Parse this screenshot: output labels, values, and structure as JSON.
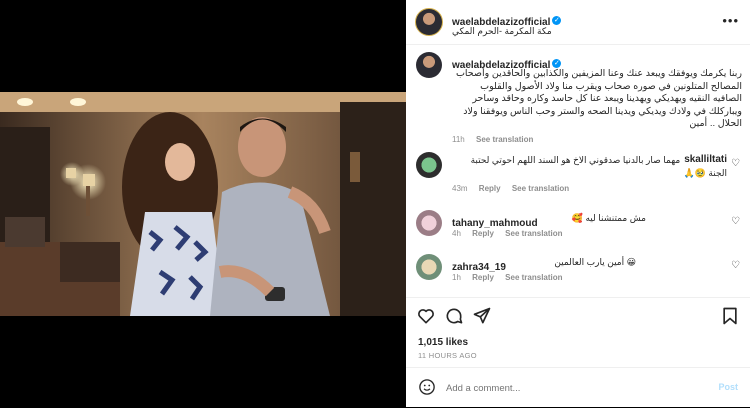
{
  "post": {
    "username": "waelabdelazizofficial",
    "location": "مكة المكرمة -الحرم المكي",
    "caption": "ربنا يكرمك ويوفقك ويبعد عنك وعنا المزيفين والكذابين والحاقدين وأصحاب المصالح المتلونين في صوره صحاب ويقرب منا ولاد الأصول والقلوب الصافيه النقيه ويهديكي ويهدينا ويبعد عنا كل حاسد وكاره وحاقد وساحر ويباركلك في ولادك ويديكي ويدينا الصحه والستر وحب الناس ويوفقنا ولاد الحلال .. أمين",
    "caption_time": "11h",
    "see_translation": "See translation",
    "likes": "1,015 likes",
    "time_ago": "11 HOURS AGO",
    "add_comment_placeholder": "Add a comment...",
    "post_button": "Post"
  },
  "comments": [
    {
      "username": "skalliltati",
      "text": "مهما صار بالدنيا صدقوني الاخ هو السند اللهم احوتي لحتبة الجنة 🥹🙏",
      "time": "43m",
      "reply": "Reply",
      "see_translation": "See translation"
    },
    {
      "username": "tahany_mahmoud",
      "text": "مش ممتنشنا ليه 🥰",
      "time": "4h",
      "reply": "Reply",
      "see_translation": "See translation"
    },
    {
      "username": "zahra34_19",
      "text": "😀 أمين يارب العالمين",
      "time": "1h",
      "reply": "Reply",
      "see_translation": "See translation"
    }
  ],
  "colors": {
    "verified": "#0095f6",
    "secondary_text": "#8e8e8e",
    "text": "#262626"
  },
  "icons": [
    "more-options-icon",
    "verified-icon",
    "heart-icon",
    "comment-icon",
    "share-icon",
    "bookmark-icon",
    "emoji-icon"
  ]
}
